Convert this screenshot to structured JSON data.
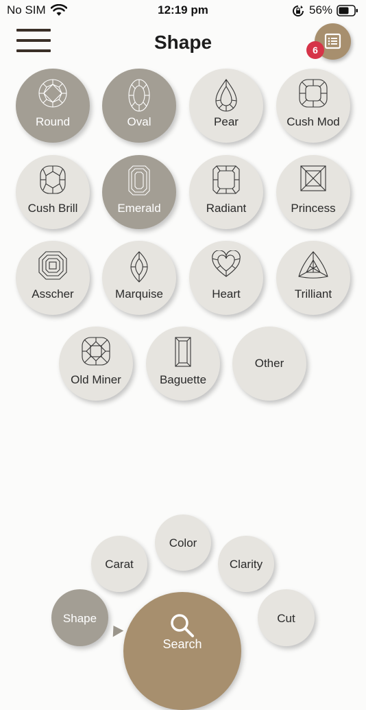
{
  "status_bar": {
    "carrier": "No SIM",
    "time": "12:19 pm",
    "battery": "56%"
  },
  "header": {
    "title": "Shape",
    "badge_count": "6"
  },
  "shapes": [
    {
      "label": "Round",
      "selected": true,
      "icon": "round-cut-icon"
    },
    {
      "label": "Oval",
      "selected": true,
      "icon": "oval-cut-icon"
    },
    {
      "label": "Pear",
      "selected": false,
      "icon": "pear-cut-icon"
    },
    {
      "label": "Cush Mod",
      "selected": false,
      "icon": "cushion-modified-cut-icon"
    },
    {
      "label": "Cush Brill",
      "selected": false,
      "icon": "cushion-brilliant-cut-icon"
    },
    {
      "label": "Emerald",
      "selected": true,
      "icon": "emerald-cut-icon"
    },
    {
      "label": "Radiant",
      "selected": false,
      "icon": "radiant-cut-icon"
    },
    {
      "label": "Princess",
      "selected": false,
      "icon": "princess-cut-icon"
    },
    {
      "label": "Asscher",
      "selected": false,
      "icon": "asscher-cut-icon"
    },
    {
      "label": "Marquise",
      "selected": false,
      "icon": "marquise-cut-icon"
    },
    {
      "label": "Heart",
      "selected": false,
      "icon": "heart-cut-icon"
    },
    {
      "label": "Trilliant",
      "selected": false,
      "icon": "trilliant-cut-icon"
    },
    {
      "label": "Old Miner",
      "selected": false,
      "icon": "old-miner-cut-icon"
    },
    {
      "label": "Baguette",
      "selected": false,
      "icon": "baguette-cut-icon"
    },
    {
      "label": "Other",
      "selected": false,
      "icon": ""
    }
  ],
  "bottom_nav": {
    "carat": "Carat",
    "color": "Color",
    "clarity": "Clarity",
    "shape": "Shape",
    "cut": "Cut",
    "search": "Search"
  },
  "colors": {
    "accent_brown": "#a78f6e",
    "selected_gray": "#a39e94",
    "unselected": "#e6e4df",
    "badge_red": "#d63448"
  }
}
